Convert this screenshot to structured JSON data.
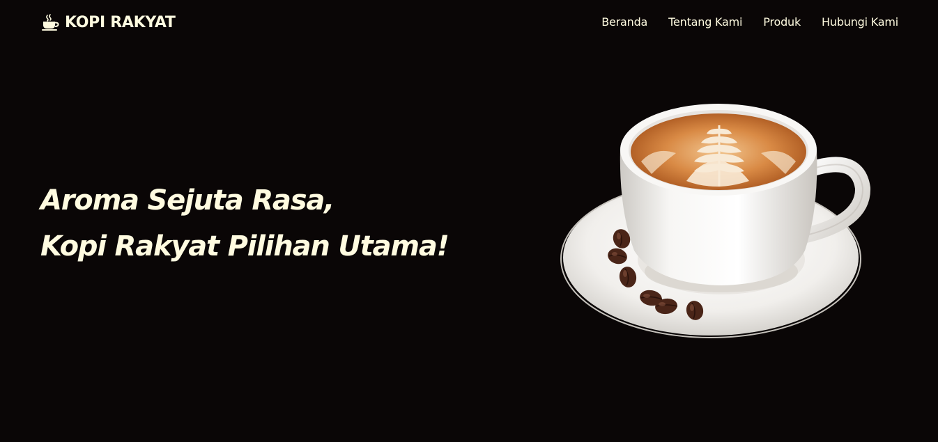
{
  "nav": {
    "brand": {
      "icon": "coffee-cup-icon",
      "name": "KOPI RAKYAT"
    },
    "links": [
      {
        "label": "Beranda"
      },
      {
        "label": "Tentang Kami"
      },
      {
        "label": "Produk"
      },
      {
        "label": "Hubungi Kami"
      }
    ]
  },
  "hero": {
    "heading_line1": "Aroma Sejuta Rasa,",
    "heading_line2": "Kopi Rakyat Pilihan Utama!",
    "image": "latte-cup-image"
  },
  "colors": {
    "background": "#0a0606",
    "text": "#fffbe0"
  }
}
